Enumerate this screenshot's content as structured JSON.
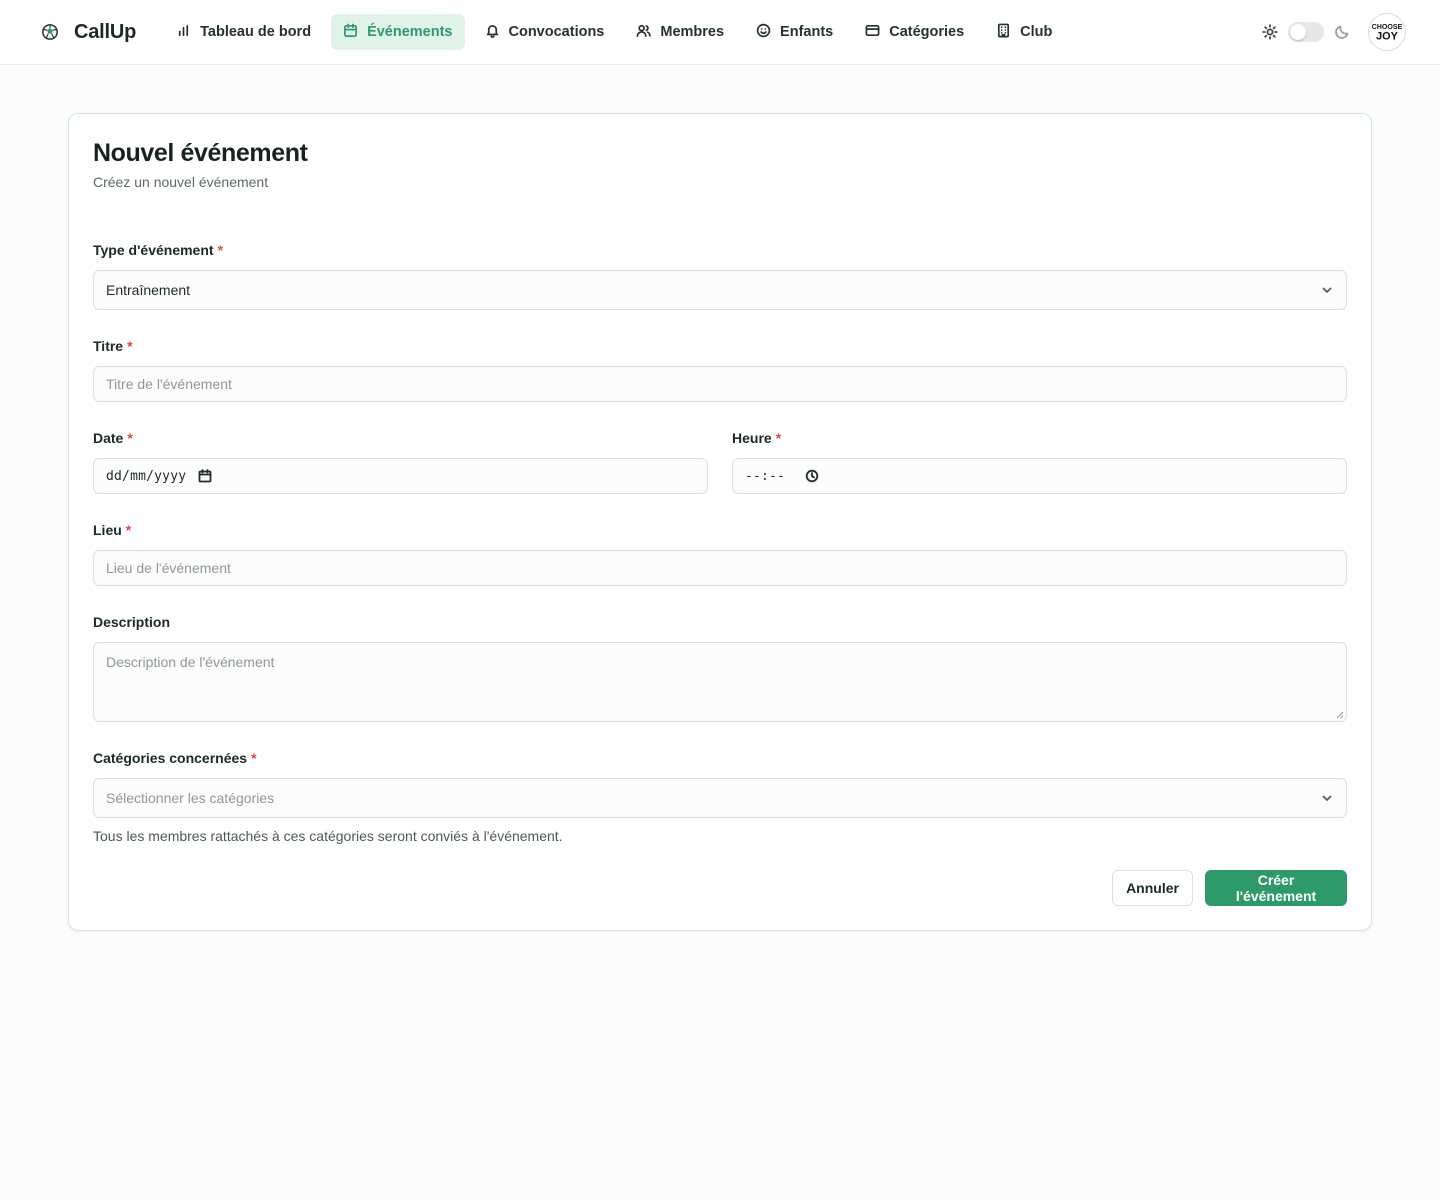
{
  "app": {
    "name": "CallUp"
  },
  "nav": {
    "items": [
      {
        "label": "Tableau de bord",
        "icon": "bar-chart-icon"
      },
      {
        "label": "Événements",
        "icon": "calendar-icon",
        "active": true
      },
      {
        "label": "Convocations",
        "icon": "bell-icon"
      },
      {
        "label": "Membres",
        "icon": "users-icon"
      },
      {
        "label": "Enfants",
        "icon": "smile-icon"
      },
      {
        "label": "Catégories",
        "icon": "card-icon"
      },
      {
        "label": "Club",
        "icon": "building-icon"
      }
    ]
  },
  "theme_toggle": {
    "state": "light",
    "sun_icon": "sun-icon",
    "moon_icon": "moon-icon"
  },
  "avatar": {
    "line1": "CHOOSE",
    "line2": "JOY"
  },
  "page": {
    "title": "Nouvel événement",
    "subtitle": "Créez un nouvel événement"
  },
  "form": {
    "required_mark": "*",
    "event_type": {
      "label": "Type d'événement",
      "value": "Entraînement"
    },
    "title": {
      "label": "Titre",
      "placeholder": "Titre de l'événement"
    },
    "date": {
      "label": "Date",
      "value": "dd/mm/yyyy"
    },
    "time": {
      "label": "Heure",
      "value": "--:--"
    },
    "location": {
      "label": "Lieu",
      "placeholder": "Lieu de l'événement"
    },
    "description": {
      "label": "Description",
      "placeholder": "Description de l'événement"
    },
    "categories": {
      "label": "Catégories concernées",
      "placeholder": "Sélectionner les catégories",
      "helper": "Tous les membres rattachés à ces catégories seront conviés à l'événement."
    }
  },
  "actions": {
    "cancel": "Annuler",
    "submit": "Créer l'événement"
  },
  "colors": {
    "accent": "#2e9a6a",
    "accent_bg": "#e1f2ea",
    "required": "#e04848",
    "card_border": "#cfe8dc"
  }
}
